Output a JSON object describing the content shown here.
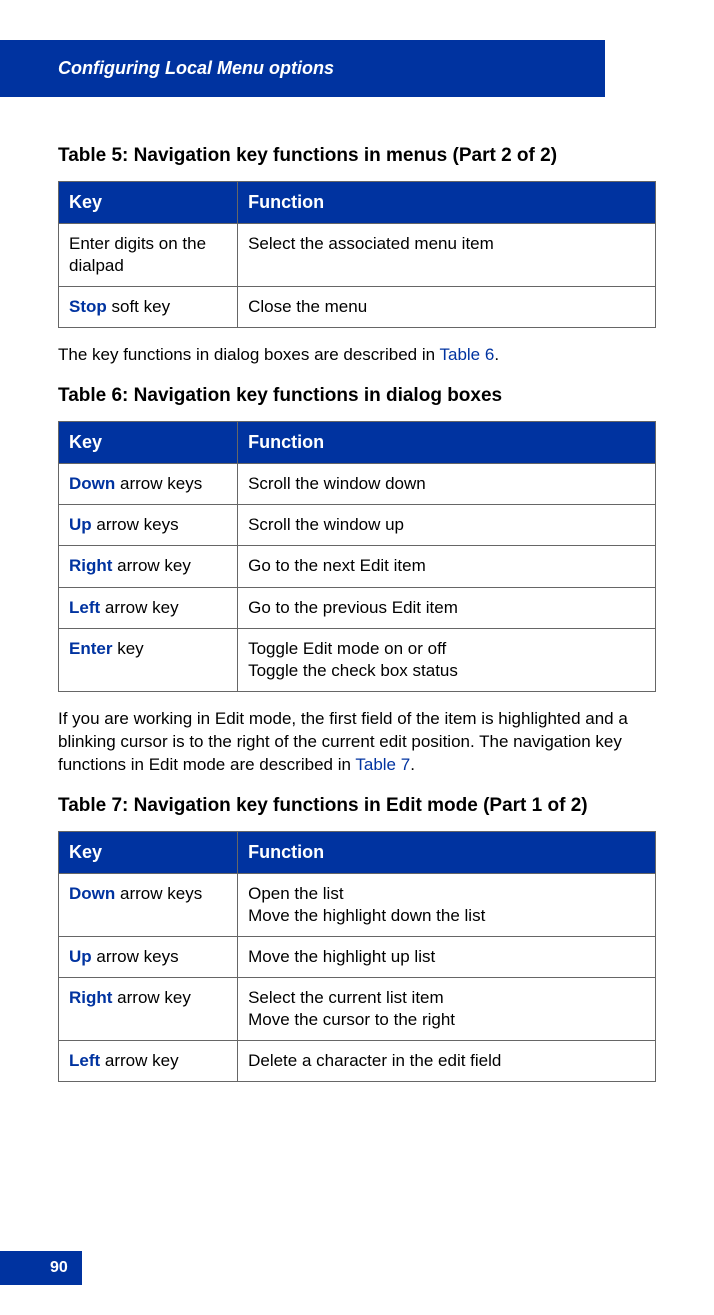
{
  "header_title": "Configuring Local Menu options",
  "page_number": "90",
  "table5": {
    "title": "Table 5: Navigation key functions in menus (Part 2 of 2)",
    "cols": {
      "key": "Key",
      "func": "Function"
    },
    "rows": [
      {
        "key_bold": "",
        "key_rest": "Enter digits on the dialpad",
        "func": "Select the associated menu item"
      },
      {
        "key_bold": "Stop",
        "key_rest": " soft key",
        "func": "Close the menu"
      }
    ]
  },
  "para1_pre": "The key functions in dialog boxes are described in ",
  "para1_link": "Table 6",
  "para1_post": ".",
  "table6": {
    "title": "Table 6: Navigation key functions in dialog boxes",
    "cols": {
      "key": "Key",
      "func": " Function"
    },
    "rows": [
      {
        "key_bold": "Down",
        "key_rest": " arrow keys",
        "func": "Scroll the window down"
      },
      {
        "key_bold": "Up",
        "key_rest": " arrow keys",
        "func": "Scroll the window up"
      },
      {
        "key_bold": "Right",
        "key_rest": " arrow key",
        "func": "Go to the next Edit item"
      },
      {
        "key_bold": "Left",
        "key_rest": " arrow key",
        "func": "Go to the previous Edit item"
      },
      {
        "key_bold": "Enter",
        "key_rest": " key",
        "func": "Toggle Edit mode on or off\nToggle the check box status"
      }
    ]
  },
  "para2_pre": "If you are working in Edit mode, the first field of the item is highlighted and a blinking cursor is to the right of the current edit position. The navigation key functions in Edit mode are described in ",
  "para2_link": "Table 7",
  "para2_post": ".",
  "table7": {
    "title": "Table 7: Navigation key functions in Edit mode (Part 1 of 2)",
    "cols": {
      "key": "Key",
      "func": "Function"
    },
    "rows": [
      {
        "key_bold": "Down",
        "key_rest": " arrow keys",
        "func": "Open the list\nMove the highlight down the list"
      },
      {
        "key_bold": "Up",
        "key_rest": " arrow keys",
        "func": "Move the highlight up list"
      },
      {
        "key_bold": "Right",
        "key_rest": " arrow key",
        "func": "Select the current list item\nMove the cursor to the right"
      },
      {
        "key_bold": "Left",
        "key_rest": " arrow key",
        "func": "Delete a character in the edit field"
      }
    ]
  }
}
